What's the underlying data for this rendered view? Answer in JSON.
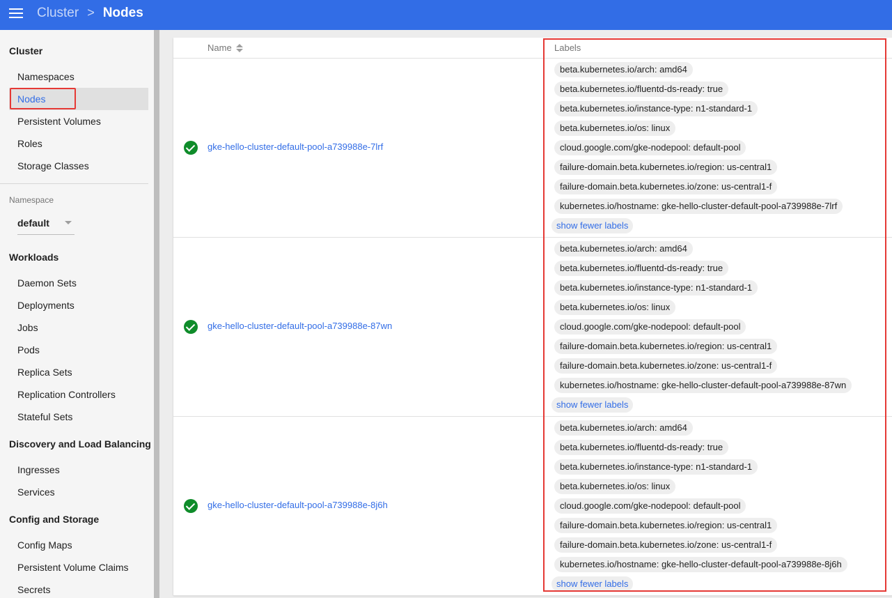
{
  "header": {
    "breadcrumb_root": "Cluster",
    "breadcrumb_separator": ">",
    "breadcrumb_current": "Nodes",
    "color": "#326de6"
  },
  "sidebar": {
    "cluster": {
      "title": "Cluster",
      "items": [
        "Namespaces",
        "Nodes",
        "Persistent Volumes",
        "Roles",
        "Storage Classes"
      ],
      "active": "Nodes"
    },
    "namespace": {
      "label": "Namespace",
      "value": "default"
    },
    "workloads": {
      "title": "Workloads",
      "items": [
        "Daemon Sets",
        "Deployments",
        "Jobs",
        "Pods",
        "Replica Sets",
        "Replication Controllers",
        "Stateful Sets"
      ]
    },
    "discovery": {
      "title": "Discovery and Load Balancing",
      "items": [
        "Ingresses",
        "Services"
      ]
    },
    "config": {
      "title": "Config and Storage",
      "items": [
        "Config Maps",
        "Persistent Volume Claims",
        "Secrets"
      ]
    }
  },
  "table": {
    "columns": {
      "name": "Name",
      "labels": "Labels"
    },
    "show_fewer": "show fewer labels",
    "rows": [
      {
        "name": "gke-hello-cluster-default-pool-a739988e-7lrf",
        "labels": [
          "beta.kubernetes.io/arch: amd64",
          "beta.kubernetes.io/fluentd-ds-ready: true",
          "beta.kubernetes.io/instance-type: n1-standard-1",
          "beta.kubernetes.io/os: linux",
          "cloud.google.com/gke-nodepool: default-pool",
          "failure-domain.beta.kubernetes.io/region: us-central1",
          "failure-domain.beta.kubernetes.io/zone: us-central1-f",
          "kubernetes.io/hostname: gke-hello-cluster-default-pool-a739988e-7lrf"
        ]
      },
      {
        "name": "gke-hello-cluster-default-pool-a739988e-87wn",
        "labels": [
          "beta.kubernetes.io/arch: amd64",
          "beta.kubernetes.io/fluentd-ds-ready: true",
          "beta.kubernetes.io/instance-type: n1-standard-1",
          "beta.kubernetes.io/os: linux",
          "cloud.google.com/gke-nodepool: default-pool",
          "failure-domain.beta.kubernetes.io/region: us-central1",
          "failure-domain.beta.kubernetes.io/zone: us-central1-f",
          "kubernetes.io/hostname: gke-hello-cluster-default-pool-a739988e-87wn"
        ]
      },
      {
        "name": "gke-hello-cluster-default-pool-a739988e-8j6h",
        "labels": [
          "beta.kubernetes.io/arch: amd64",
          "beta.kubernetes.io/fluentd-ds-ready: true",
          "beta.kubernetes.io/instance-type: n1-standard-1",
          "beta.kubernetes.io/os: linux",
          "cloud.google.com/gke-nodepool: default-pool",
          "failure-domain.beta.kubernetes.io/region: us-central1",
          "failure-domain.beta.kubernetes.io/zone: us-central1-f",
          "kubernetes.io/hostname: gke-hello-cluster-default-pool-a739988e-8j6h"
        ]
      }
    ]
  },
  "icons": {
    "menu": "menu-icon",
    "status": "check-circle-icon",
    "sort": "sort-icon",
    "dropdown": "caret-down-icon"
  },
  "colors": {
    "accent": "#326de6",
    "success": "#0f8c2a",
    "highlight": "#e53935"
  }
}
